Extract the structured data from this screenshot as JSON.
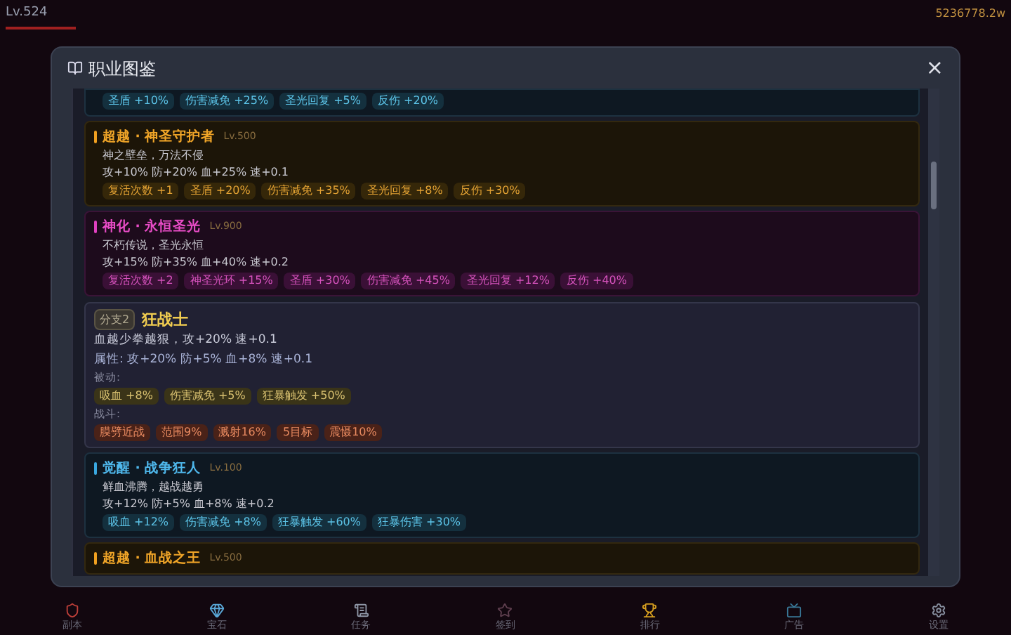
{
  "hud": {
    "level": "Lv.524",
    "gold": "5236778.2w"
  },
  "dialog": {
    "title": "职业图鉴",
    "close": "×"
  },
  "entries": [
    {
      "kind": "awaken",
      "tags": [
        "圣盾 +10%",
        "伤害减免 +25%",
        "圣光回复 +5%",
        "反伤 +20%"
      ]
    },
    {
      "kind": "transcend",
      "title": "超越 · 神圣守护者",
      "level": "Lv.500",
      "motto": "神之壁垒，万法不侵",
      "stats": "攻+10% 防+20% 血+25% 速+0.1",
      "tags": [
        "复活次数 +1",
        "圣盾 +20%",
        "伤害减免 +35%",
        "圣光回复 +8%",
        "反伤 +30%"
      ]
    },
    {
      "kind": "divine",
      "title": "神化 · 永恒圣光",
      "level": "Lv.900",
      "motto": "不朽传说，圣光永恒",
      "stats": "攻+15% 防+35% 血+40% 速+0.2",
      "tags": [
        "复活次数 +2",
        "神圣光环 +15%",
        "圣盾 +30%",
        "伤害减免 +45%",
        "圣光回复 +12%",
        "反伤 +40%"
      ]
    },
    {
      "kind": "branch",
      "badge": "分支2",
      "name": "狂战士",
      "desc": "血越少拳越狠，攻+20% 速+0.1",
      "attrs": "属性: 攻+20% 防+5% 血+8% 速+0.1",
      "passive_label": "被动:",
      "passive": [
        "吸血 +8%",
        "伤害减免 +5%",
        "狂暴触发 +50%"
      ],
      "combat_label": "战斗:",
      "combat": [
        "膜劈近战",
        "范围9%",
        "溅射16%",
        "5目标",
        "震慑10%"
      ]
    },
    {
      "kind": "awaken",
      "title": "觉醒 · 战争狂人",
      "level": "Lv.100",
      "motto": "鲜血沸腾，越战越勇",
      "stats": "攻+12% 防+5% 血+8% 速+0.2",
      "tags": [
        "吸血 +12%",
        "伤害减免 +8%",
        "狂暴触发 +60%",
        "狂暴伤害 +30%"
      ]
    },
    {
      "kind": "transcend",
      "title": "超越 · 血战之王",
      "level": "Lv.500"
    }
  ],
  "nav": [
    {
      "label": "副本"
    },
    {
      "label": "宝石"
    },
    {
      "label": "任务"
    },
    {
      "label": "签到"
    },
    {
      "label": "排行"
    },
    {
      "label": "广告"
    },
    {
      "label": "设置"
    }
  ]
}
